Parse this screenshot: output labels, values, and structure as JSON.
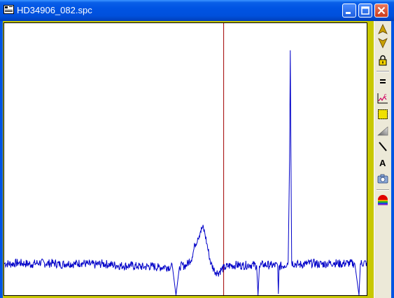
{
  "window": {
    "title": "HD34906_082.spc",
    "colors": {
      "titlebar": "#0054e3",
      "client_background": "#c8c800",
      "plot_background": "#ffffff",
      "spectrum_line": "#0000c8",
      "cursor_line": "#a00000"
    }
  },
  "titlebar_buttons": [
    {
      "name": "minimize-icon"
    },
    {
      "name": "maximize-icon"
    },
    {
      "name": "close-icon"
    }
  ],
  "toolbar": {
    "items": [
      {
        "name": "arrow-up-icon"
      },
      {
        "name": "arrow-down-icon"
      },
      {
        "name": "lock-icon"
      },
      {
        "name": "equals-icon"
      },
      {
        "name": "plot-options-icon"
      },
      {
        "name": "select-region-icon"
      },
      {
        "name": "gradient-icon"
      },
      {
        "name": "line-tool-icon"
      },
      {
        "name": "text-tool-icon",
        "label": "A"
      },
      {
        "name": "camera-icon"
      },
      {
        "name": "rainbow-palette-icon"
      }
    ]
  },
  "chart_data": {
    "type": "line",
    "title": "",
    "xlabel": "",
    "ylabel": "",
    "grid": false,
    "xlim": [
      0,
      517
    ],
    "ylim": [
      0,
      100
    ],
    "cursor_x": 313,
    "series": [
      {
        "values_description_points": [
          [
            0,
            11.7
          ],
          [
            10,
            11.5
          ],
          [
            20,
            11.9
          ],
          [
            30,
            11.6
          ],
          [
            40,
            11.4
          ],
          [
            50,
            12.0
          ],
          [
            60,
            11.6
          ],
          [
            70,
            11.8
          ],
          [
            80,
            11.3
          ],
          [
            90,
            11.7
          ],
          [
            100,
            11.5
          ],
          [
            110,
            11.9
          ],
          [
            120,
            11.4
          ],
          [
            130,
            11.2
          ],
          [
            140,
            11.6
          ],
          [
            150,
            11.3
          ],
          [
            160,
            11.0
          ],
          [
            170,
            10.8
          ],
          [
            180,
            10.9
          ],
          [
            190,
            10.6
          ],
          [
            200,
            10.4
          ],
          [
            210,
            10.7
          ],
          [
            220,
            10.2
          ],
          [
            230,
            10.5
          ],
          [
            240,
            10.3
          ],
          [
            245,
            0.0
          ],
          [
            250,
            10.6
          ],
          [
            260,
            11.0
          ],
          [
            268,
            14.0
          ],
          [
            272,
            18.5
          ],
          [
            276,
            21.0
          ],
          [
            280,
            23.5
          ],
          [
            283,
            25.0
          ],
          [
            286,
            23.0
          ],
          [
            289,
            19.0
          ],
          [
            292,
            15.0
          ],
          [
            295,
            11.5
          ],
          [
            300,
            9.0
          ],
          [
            305,
            8.2
          ],
          [
            310,
            9.5
          ],
          [
            315,
            10.2
          ],
          [
            320,
            10.8
          ],
          [
            330,
            11.1
          ],
          [
            340,
            10.9
          ],
          [
            350,
            11.2
          ],
          [
            360,
            11.0
          ],
          [
            362,
            0.0
          ],
          [
            364,
            10.8
          ],
          [
            370,
            11.3
          ],
          [
            380,
            11.0
          ],
          [
            390,
            10.9
          ],
          [
            391,
            0.5
          ],
          [
            392,
            10.6
          ],
          [
            400,
            11.0
          ],
          [
            405,
            12.0
          ],
          [
            407,
            50.0
          ],
          [
            408,
            90.0
          ],
          [
            409,
            50.0
          ],
          [
            410,
            12.0
          ],
          [
            420,
            11.2
          ],
          [
            430,
            11.5
          ],
          [
            440,
            11.8
          ],
          [
            450,
            11.4
          ],
          [
            460,
            11.6
          ],
          [
            470,
            11.9
          ],
          [
            480,
            11.5
          ],
          [
            490,
            11.8
          ],
          [
            500,
            11.6
          ],
          [
            506,
            0.0
          ],
          [
            508,
            11.7
          ],
          [
            517,
            11.9
          ]
        ]
      }
    ]
  }
}
